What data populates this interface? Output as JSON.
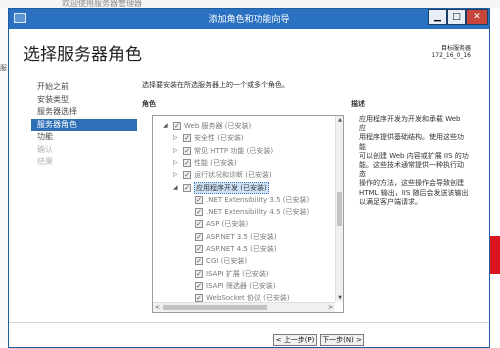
{
  "background": {
    "top_text": "欢迎使用服务器管理器",
    "left_text": "服"
  },
  "window": {
    "title": "添加角色和功能向导",
    "app_icon": "server-manager-icon",
    "controls": {
      "minimize": "▁",
      "maximize": "□",
      "close": "✕"
    }
  },
  "page": {
    "heading": "选择服务器角色",
    "target_label": "目标服务器",
    "target_name": "172_16_0_16",
    "intro": "选择要安装在所选服务器上的一个或多个角色。",
    "roles_header": "角色",
    "description_header": "描述"
  },
  "nav": [
    {
      "label": "开始之前",
      "state": "normal"
    },
    {
      "label": "安装类型",
      "state": "normal"
    },
    {
      "label": "服务器选择",
      "state": "normal"
    },
    {
      "label": "服务器角色",
      "state": "active"
    },
    {
      "label": "功能",
      "state": "normal"
    },
    {
      "label": "确认",
      "state": "disabled"
    },
    {
      "label": "结果",
      "state": "disabled"
    }
  ],
  "tree": [
    {
      "label": "Web 服务器 (已安装)",
      "indent": 0,
      "expander": "◢",
      "checked": true,
      "selected": false
    },
    {
      "label": "安全性 (已安装)",
      "indent": 1,
      "expander": "▷",
      "checked": true,
      "selected": false
    },
    {
      "label": "常见 HTTP 功能 (已安装)",
      "indent": 1,
      "expander": "▷",
      "checked": true,
      "selected": false
    },
    {
      "label": "性能 (已安装)",
      "indent": 1,
      "expander": "▷",
      "checked": true,
      "selected": false
    },
    {
      "label": "运行状况和诊断 (已安装)",
      "indent": 1,
      "expander": "▷",
      "checked": true,
      "selected": false
    },
    {
      "label": "应用程序开发 (已安装)",
      "indent": 1,
      "expander": "◢",
      "checked": true,
      "selected": true
    },
    {
      "label": ".NET Extensibility 3.5 (已安装)",
      "indent": 2,
      "expander": "",
      "checked": true,
      "selected": false
    },
    {
      "label": ".NET Extensibility 4.5 (已安装)",
      "indent": 2,
      "expander": "",
      "checked": true,
      "selected": false
    },
    {
      "label": "ASP (已安装)",
      "indent": 2,
      "expander": "",
      "checked": true,
      "selected": false
    },
    {
      "label": "ASP.NET 3.5 (已安装)",
      "indent": 2,
      "expander": "",
      "checked": true,
      "selected": false
    },
    {
      "label": "ASP.NET 4.5 (已安装)",
      "indent": 2,
      "expander": "",
      "checked": true,
      "selected": false
    },
    {
      "label": "CGI (已安装)",
      "indent": 2,
      "expander": "",
      "checked": true,
      "selected": false
    },
    {
      "label": "ISAPI 扩展 (已安装)",
      "indent": 2,
      "expander": "",
      "checked": true,
      "selected": false
    },
    {
      "label": "ISAPI 筛选器 (已安装)",
      "indent": 2,
      "expander": "",
      "checked": true,
      "selected": false
    },
    {
      "label": "WebSocket 协议 (已安装)",
      "indent": 2,
      "expander": "",
      "checked": true,
      "selected": false
    }
  ],
  "description_lines": [
    "应用程序开发为开发和承载 Web 应",
    "用程序提供基础结构。使用这些功能",
    "可以创建 Web 内容或扩展 IIS 的功",
    "能。这些技术通常提供一种执行动态",
    "操作的方法，这些操作会导致创建",
    "HTML 输出，IIS 随后会发送该输出",
    "以满足客户端请求。"
  ],
  "buttons": {
    "previous": "< 上一步(P)",
    "next": "下一步(N) >"
  },
  "colors": {
    "titlebar": "#2a72c1",
    "nav_active": "#2f6fb7",
    "close_button": "#c7453a",
    "selection": "#cfe4f8"
  }
}
